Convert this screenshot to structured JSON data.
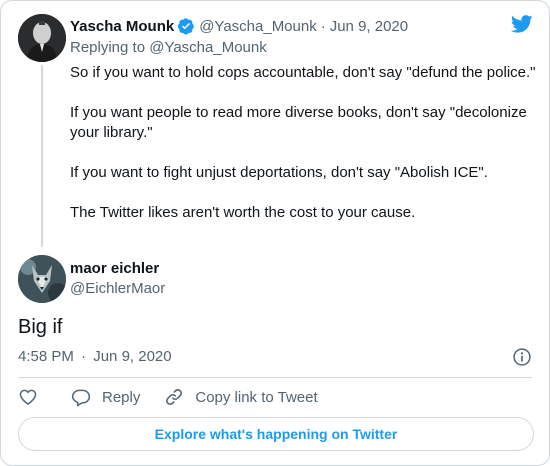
{
  "parent_tweet": {
    "author_name": "Yascha Mounk",
    "handle": "@Yascha_Mounk",
    "separator": "·",
    "date": "Jun 9, 2020",
    "replying_prefix": "Replying to",
    "replying_to": "@Yascha_Mounk",
    "paragraphs": [
      "So if you want to hold cops accountable, don't say \"defund the police.\"",
      "If you want people to read more diverse books, don't say \"decolonize your library.\"",
      "If you want to fight unjust deportations, don't say \"Abolish ICE\".",
      "The Twitter likes aren't worth the cost to your cause."
    ]
  },
  "main_tweet": {
    "author_name": "maor eichler",
    "handle": "@EichlerMaor",
    "text": "Big if",
    "time": "4:58 PM",
    "separator": "·",
    "date": "Jun 9, 2020"
  },
  "actions": {
    "reply_label": "Reply",
    "copy_label": "Copy link to Tweet"
  },
  "explore_label": "Explore what's happening on Twitter",
  "colors": {
    "twitter_blue": "#1d9bf0",
    "text_primary": "#0f1419",
    "text_secondary": "#536471",
    "border": "#cfd9de"
  },
  "icons": [
    "twitter-bird-icon",
    "verified-badge-icon",
    "info-icon",
    "heart-icon",
    "reply-bubble-icon",
    "link-icon"
  ]
}
